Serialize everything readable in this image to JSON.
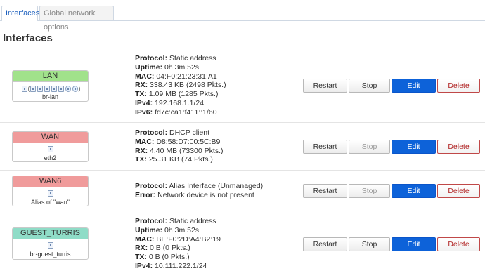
{
  "tabs": [
    "Interfaces",
    "Global network options"
  ],
  "section_title": "Interfaces",
  "buttons": {
    "restart": "Restart",
    "stop": "Stop",
    "edit": "Edit",
    "delete": "Delete"
  },
  "interfaces": [
    {
      "name": "LAN",
      "color": "#a1e28b",
      "device": "br-lan",
      "info": [
        {
          "k": "Protocol:",
          "v": " Static address"
        },
        {
          "k": "Uptime:",
          "v": " 0h 3m 52s"
        },
        {
          "k": "MAC:",
          "v": " 04:F0:21:23:31:A1"
        },
        {
          "k": "RX:",
          "v": " 338.43 KB (2498 Pkts.)"
        },
        {
          "k": "TX:",
          "v": " 1.09 MB (1285 Pkts.)"
        },
        {
          "k": "IPv4:",
          "v": " 192.168.1.1/24"
        },
        {
          "k": "IPv6:",
          "v": " fd7c:ca1:f411::1/60"
        }
      ]
    },
    {
      "name": "WAN",
      "color": "#f09b9b",
      "device": "eth2",
      "info": [
        {
          "k": "Protocol:",
          "v": " DHCP client"
        },
        {
          "k": "MAC:",
          "v": " D8:58:D7:00:5C:B9"
        },
        {
          "k": "RX:",
          "v": " 4.40 MB (73300 Pkts.)"
        },
        {
          "k": "TX:",
          "v": " 25.31 KB (74 Pkts.)"
        }
      ]
    },
    {
      "name": "WAN6",
      "color": "#f09b9b",
      "device": "Alias of \"wan\"",
      "info": [
        {
          "k": "Protocol:",
          "v": " Alias Interface (Unmanaged)"
        },
        {
          "k": "Error:",
          "v": " Network device is not present"
        }
      ]
    },
    {
      "name": "GUEST_TURRIS",
      "color": "#8fdcc7",
      "device": "br-guest_turris",
      "info": [
        {
          "k": "Protocol:",
          "v": " Static address"
        },
        {
          "k": "Uptime:",
          "v": " 0h 3m 52s"
        },
        {
          "k": "MAC:",
          "v": " BE:F0:2D:A4:B2:19"
        },
        {
          "k": "RX:",
          "v": " 0 B (0 Pkts.)"
        },
        {
          "k": "TX:",
          "v": " 0 B (0 Pkts.)"
        },
        {
          "k": "IPv4:",
          "v": " 10.111.222.1/24"
        }
      ]
    }
  ]
}
